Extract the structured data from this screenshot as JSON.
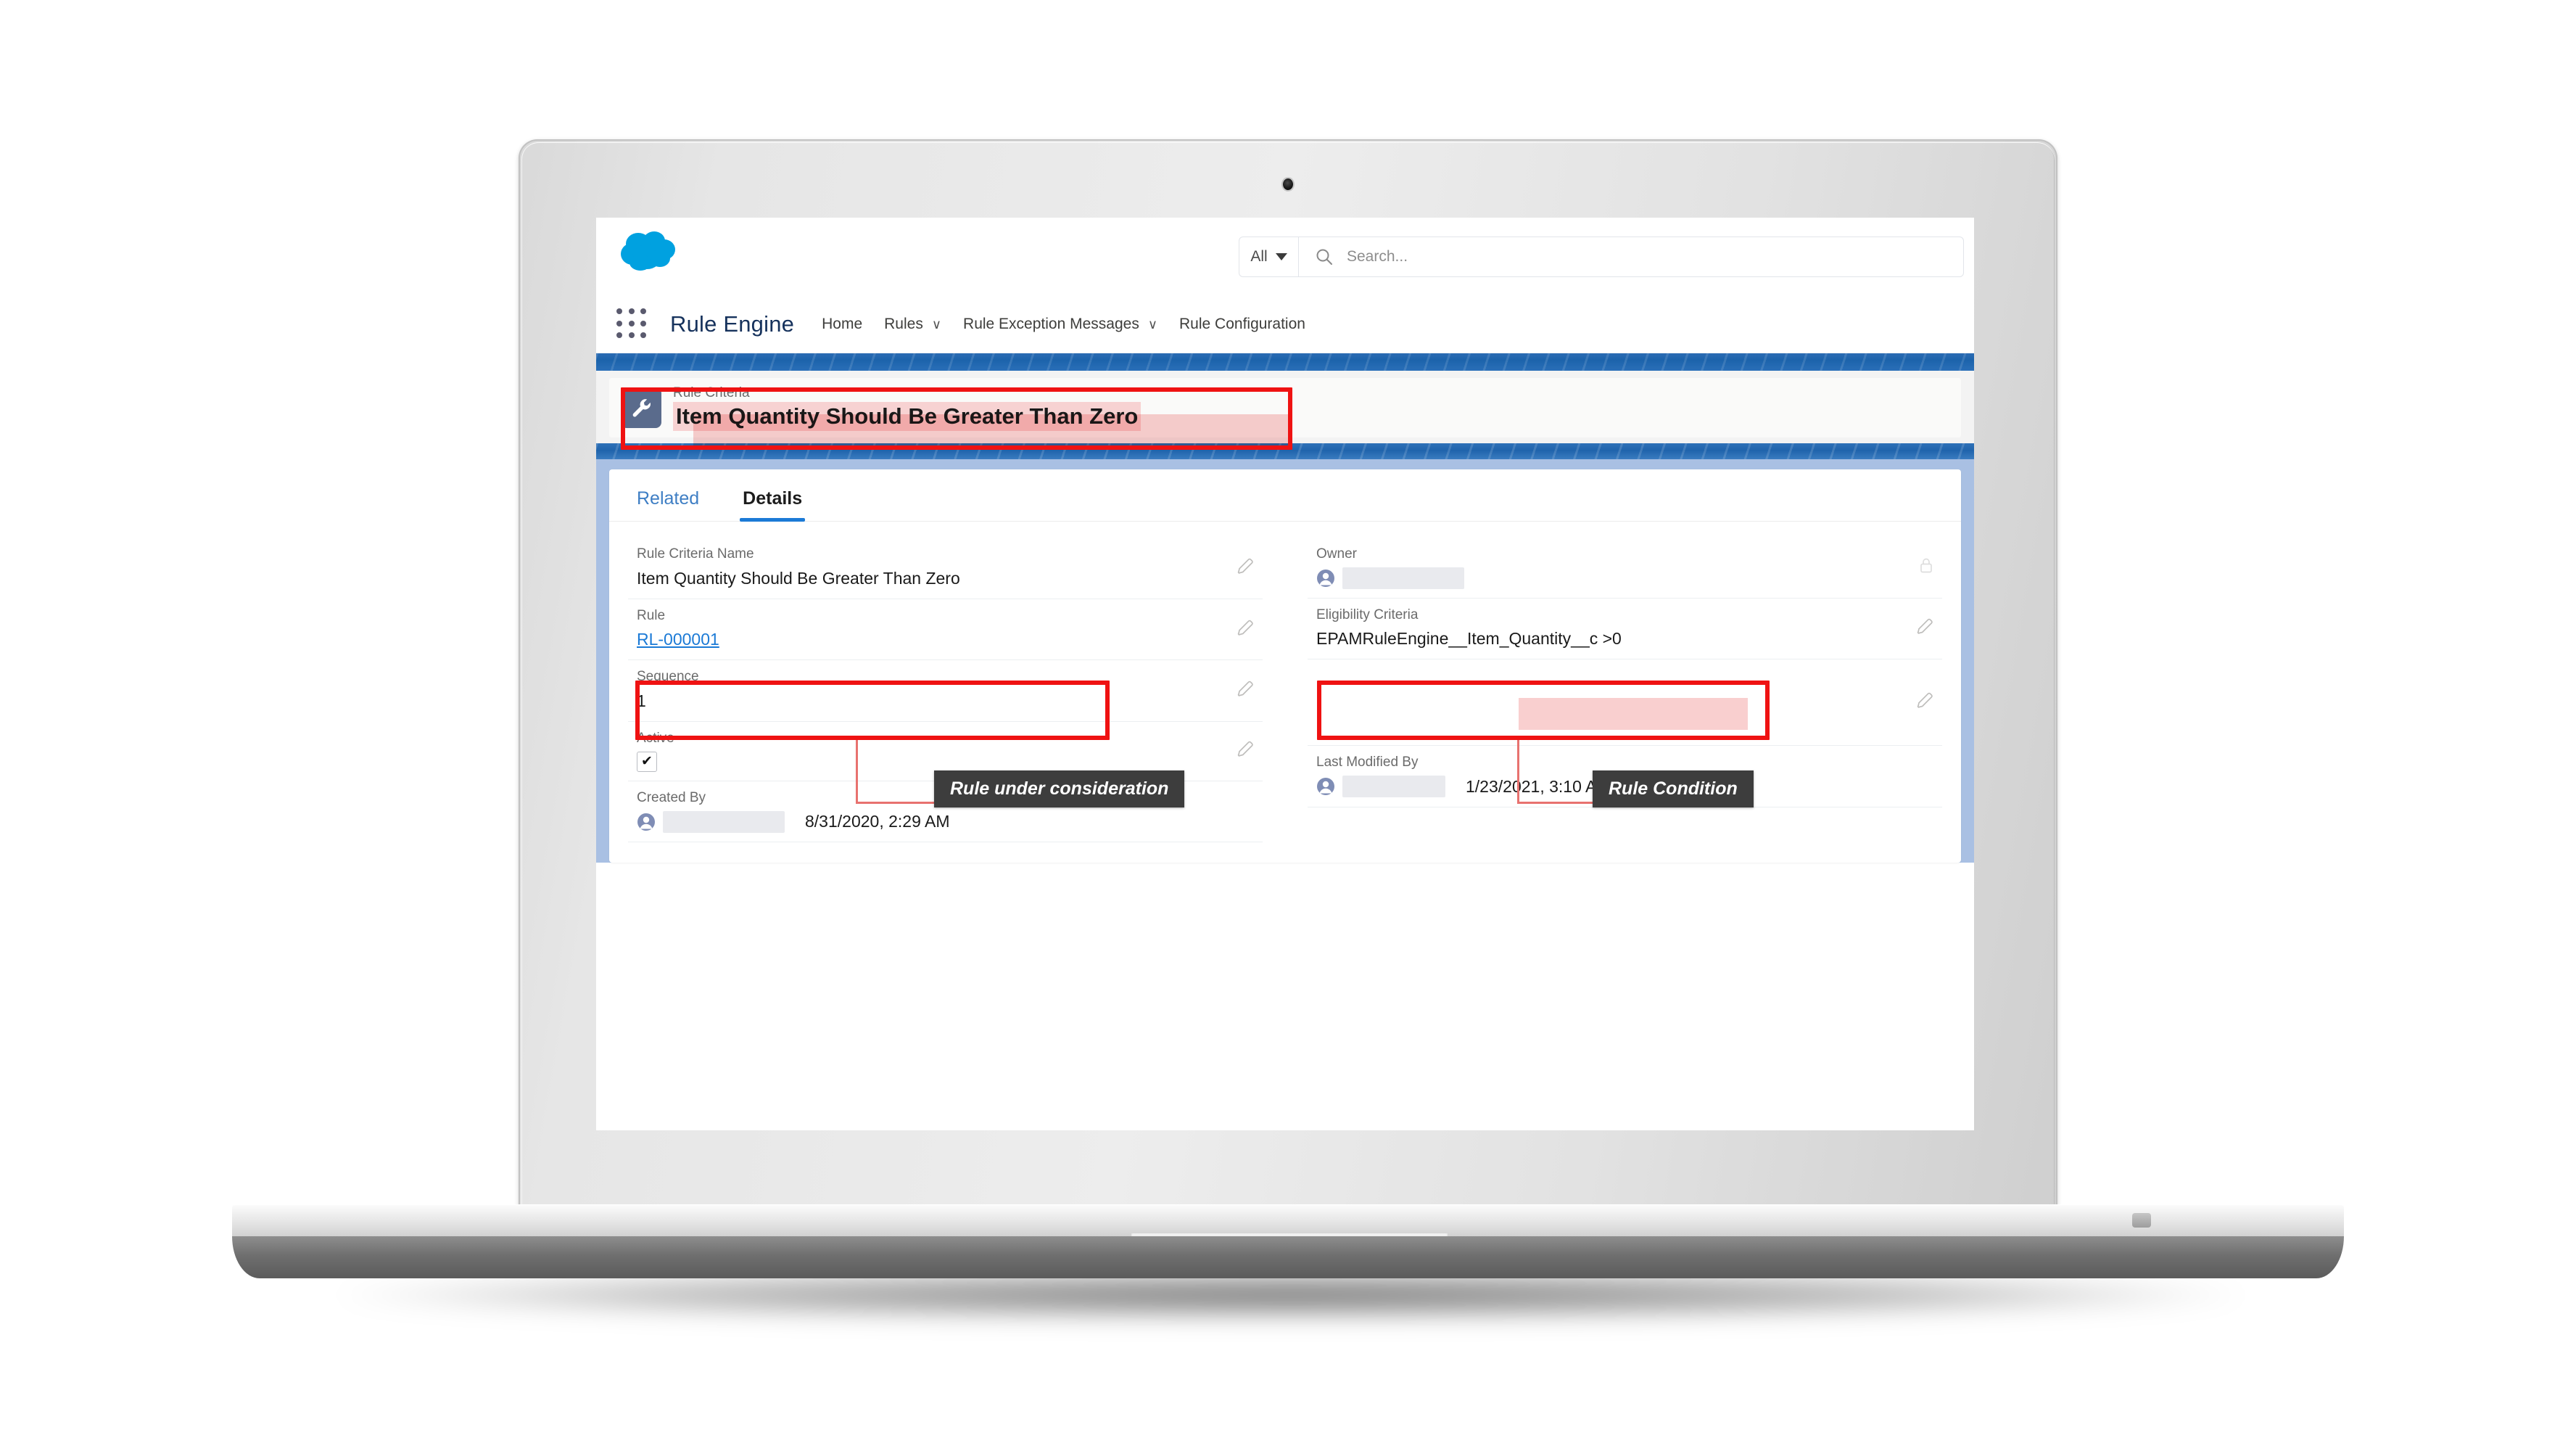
{
  "app": {
    "name": "Rule Engine",
    "logo_icon": "salesforce-cloud-logo",
    "app_launcher_icon": "app-launcher-grid-icon"
  },
  "search": {
    "scope_label": "All",
    "scope_caret_icon": "chevron-down-icon",
    "icon": "search-icon",
    "placeholder": "Search...",
    "value": ""
  },
  "nav": {
    "items": [
      {
        "label": "Home",
        "has_menu": false,
        "chevron": ""
      },
      {
        "label": "Rules",
        "has_menu": true,
        "chevron": "∨"
      },
      {
        "label": "Rule Exception Messages",
        "has_menu": true,
        "chevron": "∨"
      },
      {
        "label": "Rule Configuration",
        "has_menu": false,
        "chevron": ""
      }
    ]
  },
  "record_header": {
    "icon": "wrench-icon",
    "object_label": "Rule Criteria",
    "title": "Item Quantity Should Be Greater Than Zero",
    "icon_bg": "#5a6b8c",
    "highlight_color": "#f7d2d2"
  },
  "tabs": [
    {
      "label": "Related",
      "active": false
    },
    {
      "label": "Details",
      "active": true
    }
  ],
  "details": {
    "left": [
      {
        "label": "Rule Criteria Name",
        "value": "Item Quantity Should Be Greater Than Zero",
        "type": "text",
        "edit_icon": "pencil-icon"
      },
      {
        "label": "Rule",
        "value": "RL-000001",
        "type": "link",
        "edit_icon": "pencil-icon"
      },
      {
        "label": "Sequence",
        "value": "1",
        "type": "text",
        "edit_icon": "pencil-icon"
      },
      {
        "label": "Active",
        "value": "✔",
        "type": "checkbox",
        "checked": true,
        "edit_icon": "pencil-icon"
      },
      {
        "label": "Created By",
        "value": "",
        "avatar_icon": "user-avatar-icon",
        "redacted": true,
        "timestamp": "8/31/2020, 2:29 AM",
        "type": "user"
      }
    ],
    "right": [
      {
        "label": "Owner",
        "value": "",
        "avatar_icon": "user-avatar-icon",
        "redacted": true,
        "type": "user",
        "edit_icon": "lock-icon"
      },
      {
        "label": "Eligibility Criteria",
        "value": "EPAMRuleEngine__Item_Quantity__c >0",
        "type": "text",
        "edit_icon": "pencil-icon"
      },
      {
        "label": "Last Modified By",
        "value": "",
        "avatar_icon": "user-avatar-icon",
        "redacted": true,
        "timestamp": "1/23/2021, 3:10 AM",
        "type": "user"
      }
    ]
  },
  "annotations": {
    "callouts": [
      {
        "id": "rule-under-consideration",
        "text": "Rule under consideration"
      },
      {
        "id": "rule-condition",
        "text": "Rule Condition"
      }
    ],
    "box_color": "#ef1212",
    "leader_color": "#e8726f",
    "tooltip_bg": "#3d3d3d"
  },
  "colors": {
    "brand_blue": "#1b7ad6",
    "banner_blue": "#1c63ab",
    "page_blue": "#a9c0e3",
    "link": "#1b7ad6"
  }
}
